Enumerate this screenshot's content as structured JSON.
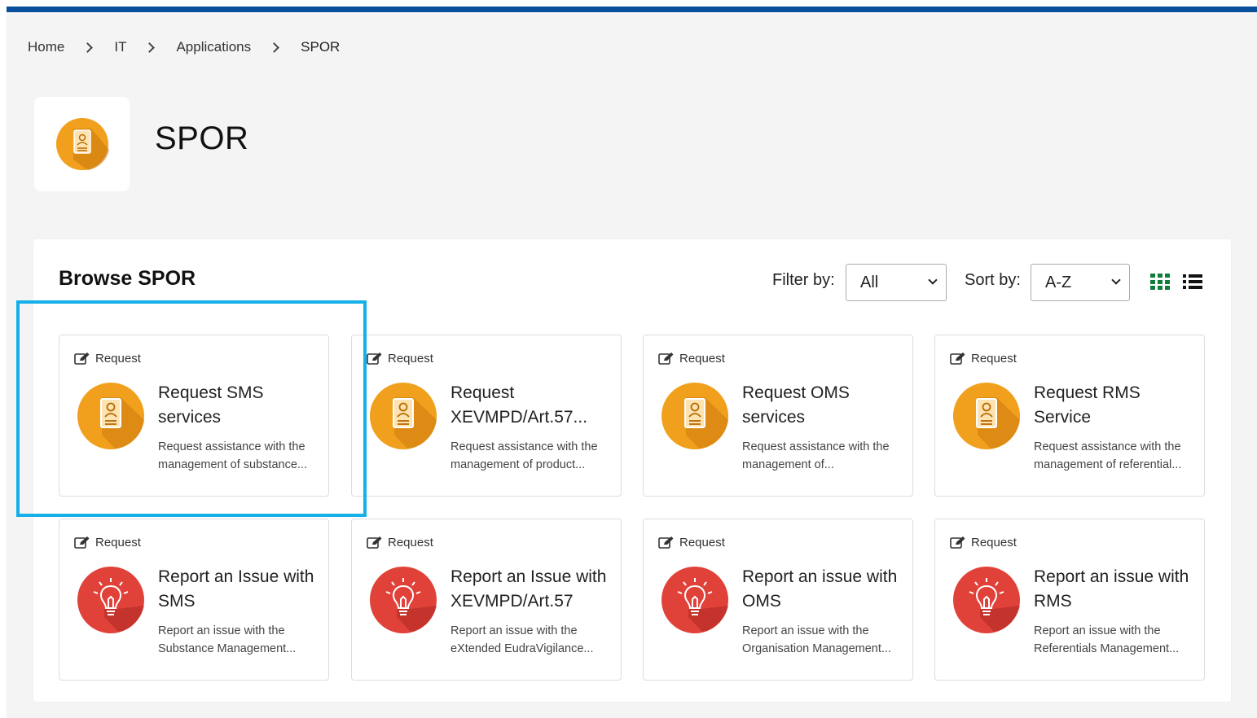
{
  "breadcrumb": [
    "Home",
    "IT",
    "Applications",
    "SPOR"
  ],
  "page": {
    "title": "SPOR"
  },
  "browse": {
    "title": "Browse SPOR",
    "filter_label": "Filter by:",
    "filter_value": "All",
    "sort_label": "Sort by:",
    "sort_value": "A-Z",
    "grid_icon": "grid-view-icon",
    "list_icon": "list-view-icon"
  },
  "colors": {
    "top_bar": "#0a4f9c",
    "grid_active": "#0f7d3a",
    "request_icon": "#f0a01c",
    "issue_icon": "#e0423a",
    "highlight": "#15b0e8"
  },
  "cards": [
    {
      "type": "Request",
      "icon": "address-book-icon",
      "title": "Request SMS services",
      "desc": "Request assistance with the management of substance..."
    },
    {
      "type": "Request",
      "icon": "address-book-icon",
      "title": "Request XEVMPD/Art.57...",
      "desc": "Request assistance with the management of product..."
    },
    {
      "type": "Request",
      "icon": "address-book-icon",
      "title": "Request OMS services",
      "desc": "Request assistance with the management of..."
    },
    {
      "type": "Request",
      "icon": "address-book-icon",
      "title": "Request RMS Service",
      "desc": "Request assistance with the management of referential..."
    },
    {
      "type": "Request",
      "icon": "lightbulb-icon",
      "title": "Report an Issue with SMS",
      "desc": "Report an issue with the Substance Management..."
    },
    {
      "type": "Request",
      "icon": "lightbulb-icon",
      "title": "Report an Issue with XEVMPD/Art.57",
      "desc": "Report an issue with the eXtended EudraVigilance..."
    },
    {
      "type": "Request",
      "icon": "lightbulb-icon",
      "title": "Report an issue with OMS",
      "desc": "Report an issue with the Organisation Management..."
    },
    {
      "type": "Request",
      "icon": "lightbulb-icon",
      "title": "Report an issue with RMS",
      "desc": "Report an issue with the Referentials Management..."
    }
  ]
}
